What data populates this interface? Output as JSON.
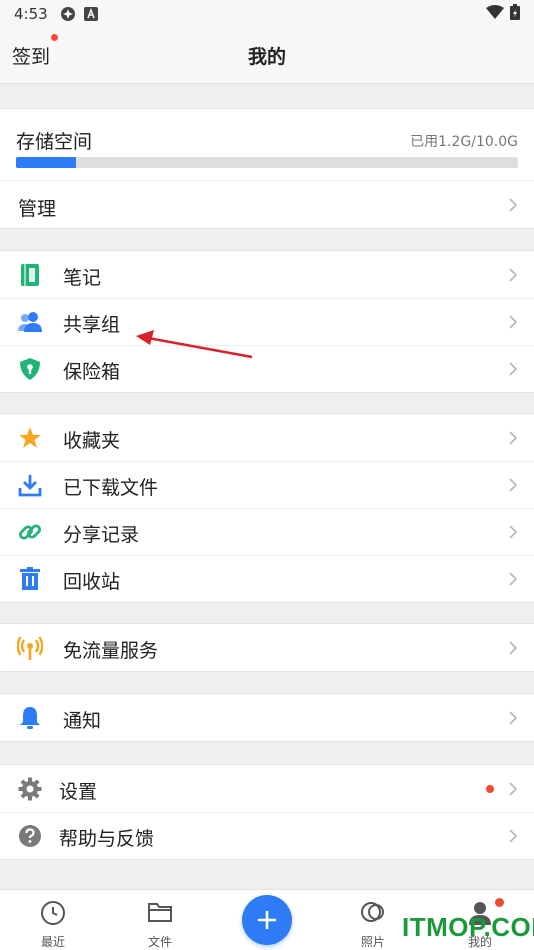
{
  "status_bar": {
    "time": "4:53"
  },
  "header": {
    "checkin_label": "签到",
    "title": "我的"
  },
  "storage": {
    "title": "存储空间",
    "used_text": "已用1.2G/10.0G",
    "used_fraction": 0.12,
    "manage_label": "管理"
  },
  "tools": [
    {
      "label": "笔记",
      "icon": "notebook-icon"
    },
    {
      "label": "共享组",
      "icon": "users-icon"
    },
    {
      "label": "保险箱",
      "icon": "shield-lock-icon"
    }
  ],
  "files": [
    {
      "label": "收藏夹",
      "icon": "star-icon"
    },
    {
      "label": "已下载文件",
      "icon": "download-icon"
    },
    {
      "label": "分享记录",
      "icon": "link-icon"
    },
    {
      "label": "回收站",
      "icon": "trash-icon"
    }
  ],
  "traffic": {
    "label": "免流量服务",
    "icon": "signal-icon"
  },
  "notify": {
    "label": "通知",
    "icon": "bell-icon"
  },
  "settings": {
    "label": "设置",
    "icon": "gear-icon"
  },
  "help": {
    "label": "帮助与反馈",
    "icon": "question-icon"
  },
  "bottom_nav": {
    "recent": "最近",
    "files": "文件",
    "photos": "照片",
    "mine": "我的"
  },
  "watermark": "ITMOP.COM",
  "colors": {
    "accent": "#2e7bf6",
    "notebook": "#1fb57a",
    "star": "#f6a623",
    "link": "#24b37a",
    "signal": "#f6a623",
    "badge": "#f24a2e"
  }
}
